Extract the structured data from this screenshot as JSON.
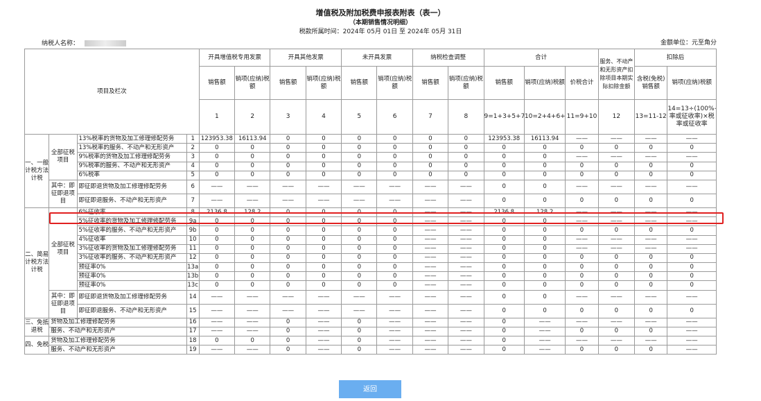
{
  "header": {
    "title": "增值税及附加税费申报表附表（表一）",
    "subtitle": "（本期销售情况明细）",
    "period_label": "税款所属时间：",
    "period_value": "2024年 05月 01日 至 2024年 05月 31日",
    "taxpayer_label": "纳税人名称：",
    "unit_label": "金额单位：元至角分"
  },
  "table": {
    "item_header": "项目及栏次",
    "groups": [
      "开具增值税专用发票",
      "开具其他发票",
      "未开具发票",
      "纳税检查调整",
      "合计",
      "服务、不动产和无形资产扣除项目本期实际扣除金额",
      "扣除后"
    ],
    "sub_headers": {
      "sales": "销售额",
      "tax": "销项(应纳)税额",
      "total": "价税合计",
      "after_sales": "含税(免税)销售额",
      "after_tax": "销项(应纳)税额"
    },
    "col_numbers": [
      "1",
      "2",
      "3",
      "4",
      "5",
      "6",
      "7",
      "8",
      "9=1+3+5+7",
      "10=2+4+6+8",
      "11=9+10",
      "12",
      "13=11-12",
      "14=13÷(100%+税率或征收率)×税率或征收率"
    ],
    "categories": {
      "general": "一、一般计税方法计税",
      "simple": "二、简易计税方法计税",
      "exempt_refund": "三、免抵退税",
      "exempt": "四、免税",
      "all_levy": "全部征税项目",
      "refund_upon": "其中：即征即退项目"
    },
    "rows": [
      {
        "label": "13%税率的货物及加工修理修配劳务",
        "no": "1",
        "v": [
          "123953.38",
          "16113.94",
          "0",
          "0",
          "0",
          "0",
          "0",
          "0",
          "123953.38",
          "16113.94",
          "——",
          "——",
          "——",
          "——"
        ]
      },
      {
        "label": "13%税率的服务、不动产和无形资产",
        "no": "2",
        "v": [
          "0",
          "0",
          "0",
          "0",
          "0",
          "0",
          "0",
          "0",
          "0",
          "0",
          "0",
          "0",
          "0",
          "0"
        ]
      },
      {
        "label": "9%税率的货物及加工修理修配劳务",
        "no": "3",
        "v": [
          "0",
          "0",
          "0",
          "0",
          "0",
          "0",
          "0",
          "0",
          "0",
          "0",
          "——",
          "——",
          "——",
          "——"
        ]
      },
      {
        "label": "9%税率的服务、不动产和无形资产",
        "no": "4",
        "v": [
          "0",
          "0",
          "0",
          "0",
          "0",
          "0",
          "0",
          "0",
          "0",
          "0",
          "0",
          "0",
          "0",
          "0"
        ]
      },
      {
        "label": "6%税率",
        "no": "5",
        "v": [
          "0",
          "0",
          "0",
          "0",
          "0",
          "0",
          "0",
          "0",
          "0",
          "0",
          "0",
          "0",
          "0",
          "0"
        ]
      },
      {
        "label": "即征即退货物及加工修理修配劳务",
        "no": "6",
        "v": [
          "——",
          "——",
          "——",
          "——",
          "——",
          "——",
          "——",
          "——",
          "0",
          "0",
          "——",
          "——",
          "——",
          "——"
        ]
      },
      {
        "label": "即征即退服务、不动产和无形资产",
        "no": "7",
        "v": [
          "——",
          "——",
          "——",
          "——",
          "——",
          "——",
          "——",
          "——",
          "0",
          "0",
          "0",
          "0",
          "0",
          "0"
        ]
      },
      {
        "label": "6%征收率",
        "no": "8",
        "v": [
          "2136.8",
          "128.2",
          "0",
          "0",
          "0",
          "0",
          "——",
          "——",
          "2136.8",
          "128.2",
          "——",
          "——",
          "——",
          "——"
        ]
      },
      {
        "label": "5%征收率的货物及加工修理修配劳务",
        "no": "9a",
        "v": [
          "0",
          "0",
          "0",
          "0",
          "0",
          "0",
          "——",
          "——",
          "0",
          "0",
          "——",
          "——",
          "——",
          "——"
        ]
      },
      {
        "label": "5%征收率的服务、不动产和无形资产",
        "no": "9b",
        "v": [
          "0",
          "0",
          "0",
          "0",
          "0",
          "0",
          "——",
          "——",
          "0",
          "0",
          "0",
          "0",
          "0",
          "0"
        ]
      },
      {
        "label": "4%征收率",
        "no": "10",
        "v": [
          "0",
          "0",
          "0",
          "0",
          "0",
          "0",
          "——",
          "——",
          "0",
          "0",
          "——",
          "——",
          "——",
          "——"
        ]
      },
      {
        "label": "3%征收率的货物及加工修理修配劳务",
        "no": "11",
        "v": [
          "0",
          "0",
          "0",
          "0",
          "0",
          "0",
          "——",
          "——",
          "0",
          "0",
          "——",
          "——",
          "——",
          "——"
        ]
      },
      {
        "label": "3%征收率的服务、不动产和无形资产",
        "no": "12",
        "v": [
          "0",
          "0",
          "0",
          "0",
          "0",
          "0",
          "——",
          "——",
          "0",
          "0",
          "0",
          "0",
          "0",
          "0"
        ]
      },
      {
        "label": "预征率0%",
        "no": "13a",
        "v": [
          "0",
          "0",
          "0",
          "0",
          "0",
          "0",
          "——",
          "——",
          "0",
          "0",
          "0",
          "0",
          "0",
          "0"
        ]
      },
      {
        "label": "预征率0%",
        "no": "13b",
        "v": [
          "0",
          "0",
          "0",
          "0",
          "0",
          "0",
          "——",
          "——",
          "0",
          "0",
          "0",
          "0",
          "0",
          "0"
        ]
      },
      {
        "label": "预征率0%",
        "no": "13c",
        "v": [
          "0",
          "0",
          "0",
          "0",
          "0",
          "0",
          "——",
          "——",
          "0",
          "0",
          "0",
          "0",
          "0",
          "0"
        ]
      },
      {
        "label": "即征即退货物及加工修理修配劳务",
        "no": "14",
        "v": [
          "——",
          "——",
          "——",
          "——",
          "——",
          "——",
          "——",
          "——",
          "0",
          "0",
          "——",
          "——",
          "——",
          "——"
        ]
      },
      {
        "label": "即征即退服务、不动产和无形资产",
        "no": "15",
        "v": [
          "——",
          "——",
          "——",
          "——",
          "——",
          "——",
          "——",
          "——",
          "0",
          "0",
          "0",
          "0",
          "0",
          "0"
        ]
      },
      {
        "label": "货物及加工修理修配劳务",
        "no": "16",
        "v": [
          "——",
          "——",
          "0",
          "——",
          "0",
          "——",
          "——",
          "——",
          "0",
          "——",
          "——",
          "——",
          "——",
          "——"
        ]
      },
      {
        "label": "服务、不动产和无形资产",
        "no": "17",
        "v": [
          "——",
          "——",
          "0",
          "——",
          "0",
          "——",
          "——",
          "——",
          "0",
          "——",
          "0",
          "0",
          "0",
          "——"
        ]
      },
      {
        "label": "货物及加工修理修配劳务",
        "no": "18",
        "v": [
          "0",
          "0",
          "0",
          "——",
          "0",
          "——",
          "——",
          "——",
          "0",
          "——",
          "——",
          "——",
          "——",
          "——"
        ]
      },
      {
        "label": "服务、不动产和无形资产",
        "no": "19",
        "v": [
          "——",
          "——",
          "0",
          "——",
          "0",
          "——",
          "——",
          "——",
          "0",
          "——",
          "0",
          "0",
          "0",
          "——"
        ]
      }
    ]
  },
  "footer": {
    "back_label": "返回"
  },
  "colors": {
    "highlight": "#e02020",
    "button": "#6aaef0"
  }
}
